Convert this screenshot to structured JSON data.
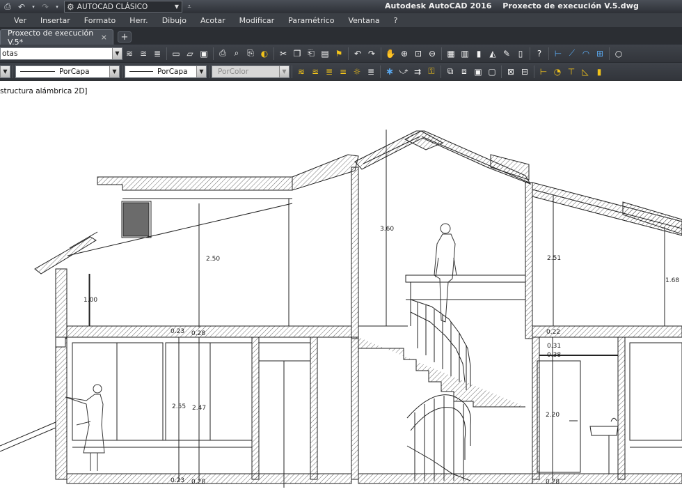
{
  "app": {
    "window_title": "Autodesk AutoCAD 2016    Proxecto de execución V.5.dwg"
  },
  "quick_access": {
    "workspace": "AUTOCAD CLÁSICO"
  },
  "menu": [
    "Ver",
    "Insertar",
    "Formato",
    "Herr.",
    "Dibujo",
    "Acotar",
    "Modificar",
    "Paramétrico",
    "Ventana",
    "?"
  ],
  "tabs": {
    "document": "Proxecto de execución V.5*",
    "close_glyph": "×",
    "new_glyph": "+"
  },
  "toolbar1": {
    "layer_combo_value": "otas"
  },
  "toolbar2": {
    "linetype_value": "PorCapa",
    "lineweight_value": "PorCapa",
    "color_value": "PorColor"
  },
  "viewport_label": "structura alámbrica 2D]",
  "dimensions": {
    "left_roof_height": "2.50",
    "left_eave_height": "1.00",
    "ridge_height": "3.60",
    "right_roof_height": "2.51",
    "right_edge_height": "1.68",
    "slab_top_a": "0.23",
    "slab_top_b": "0.28",
    "slab_right_top": "0.22",
    "right_upper_a": "0.31",
    "right_upper_b": "0.38",
    "ground_height_a": "2.55",
    "ground_height_b": "2.47",
    "door_height": "2.20",
    "slab_bottom_a": "0.23",
    "slab_bottom_b": "0.28",
    "slab_bottom_right": "0.28"
  }
}
